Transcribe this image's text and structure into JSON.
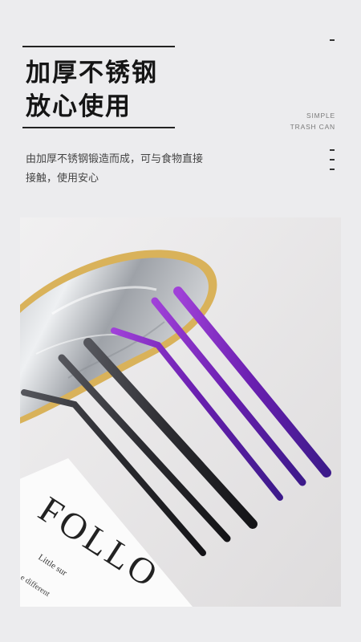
{
  "headline": {
    "line1": "加厚不锈钢",
    "line2": "放心使用"
  },
  "side_tag": {
    "line1": "SIMPLE",
    "line2": "TRASH CAN"
  },
  "description": {
    "line1": "由加厚不锈钢锻造而成，可与食物直接",
    "line2": "接触，使用安心"
  },
  "photo": {
    "card_text": "FOLLO",
    "card_small_1": "Little sur",
    "card_small_2": "e different"
  },
  "colors": {
    "background": "#ececee",
    "headline": "#151515",
    "black_straw": "#2e2e33",
    "purple_straw": "#6a1fb0",
    "tray_gold": "#d9b25a"
  }
}
